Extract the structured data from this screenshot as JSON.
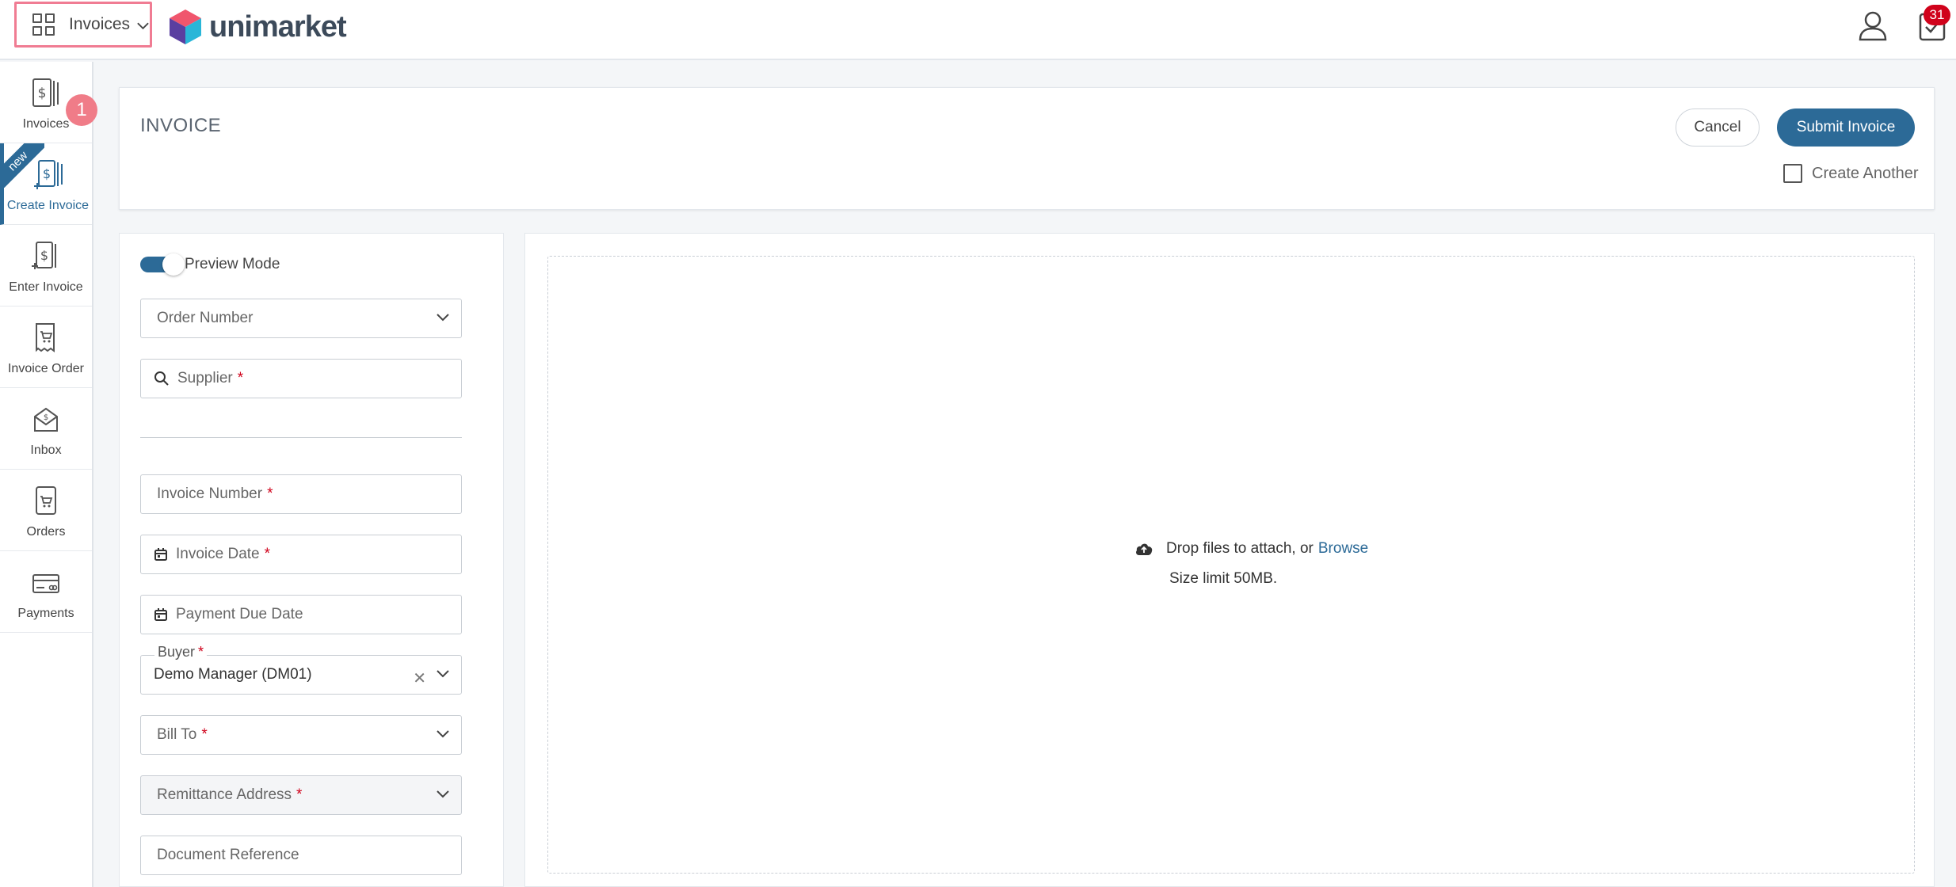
{
  "topbar": {
    "app_switcher_label": "Invoices",
    "brand": "unimarket",
    "tasks_count": "31"
  },
  "sidebar": {
    "items": [
      {
        "label": "Invoices",
        "icon": "invoice-icon"
      },
      {
        "label": "Create Invoice",
        "icon": "create-invoice-icon",
        "ribbon": "new",
        "active": true
      },
      {
        "label": "Enter Invoice",
        "icon": "enter-invoice-icon"
      },
      {
        "label": "Invoice Order",
        "icon": "invoice-order-icon"
      },
      {
        "label": "Inbox",
        "icon": "inbox-icon"
      },
      {
        "label": "Orders",
        "icon": "orders-icon"
      },
      {
        "label": "Payments",
        "icon": "payments-icon"
      }
    ],
    "step_badge": "1"
  },
  "header": {
    "title": "INVOICE",
    "cancel_label": "Cancel",
    "submit_label": "Submit Invoice",
    "create_another_label": "Create Another"
  },
  "form": {
    "preview_mode_label": "Preview Mode",
    "order_number_placeholder": "Order Number",
    "supplier_placeholder": "Supplier",
    "invoice_number_placeholder": "Invoice Number",
    "invoice_date_placeholder": "Invoice Date",
    "payment_due_date_placeholder": "Payment Due Date",
    "buyer_label": "Buyer",
    "buyer_value": "Demo Manager (DM01)",
    "bill_to_placeholder": "Bill To",
    "remittance_address_placeholder": "Remittance Address",
    "document_reference_placeholder": "Document Reference",
    "required_mark": "*"
  },
  "attachments": {
    "drop_text": "Drop files to attach, or",
    "browse_label": "Browse",
    "size_limit": "Size limit 50MB."
  },
  "colors": {
    "primary": "#2c6a97",
    "required": "#d0021b",
    "highlight": "#f07c93",
    "step_badge": "#f07c88"
  }
}
